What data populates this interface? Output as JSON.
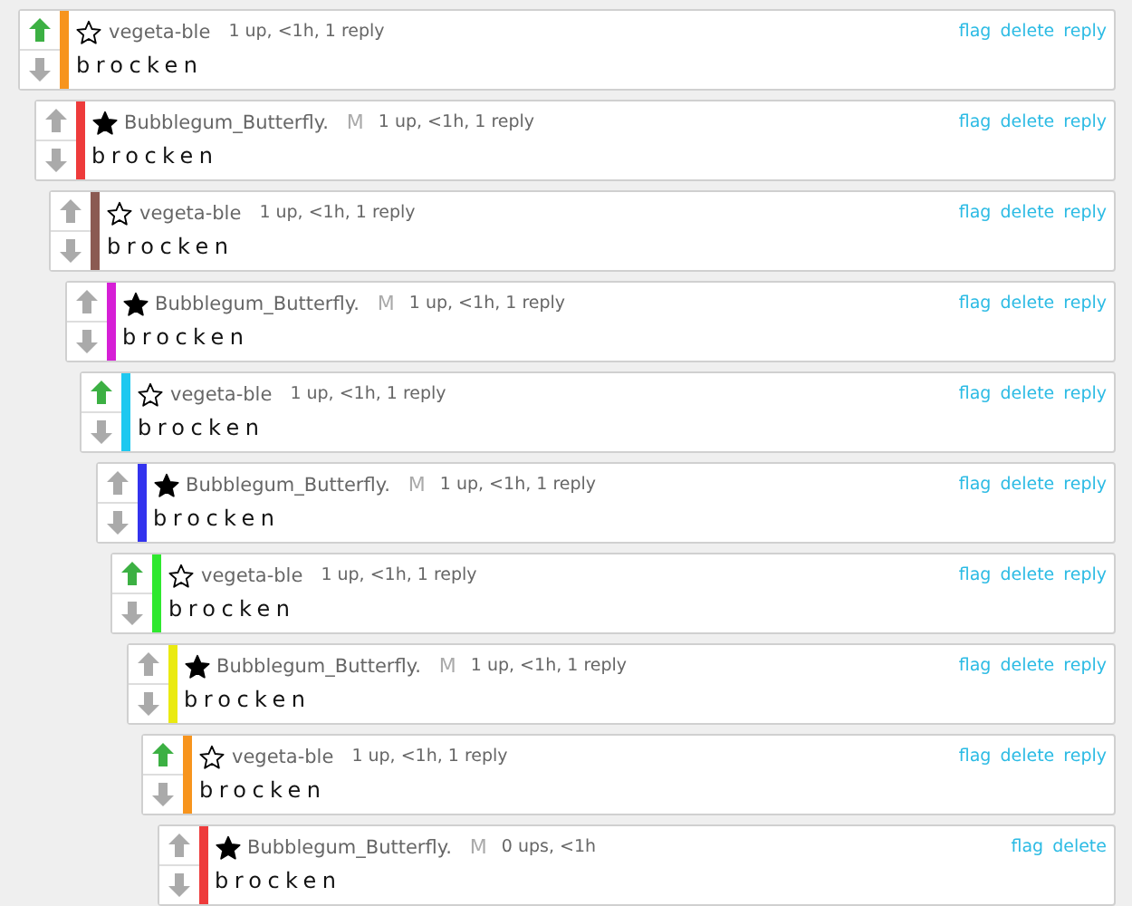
{
  "comments": [
    {
      "upvoted": true,
      "starred": false,
      "color": "#f7941d",
      "user": "vegeta-ble",
      "meta": "1 up, <1h, 1 reply",
      "body": "brocken",
      "actions": [
        "flag",
        "delete",
        "reply"
      ],
      "children": [
        {
          "upvoted": false,
          "starred": true,
          "color": "#ee3b3b",
          "user": "Bubblegum_Butterfly.",
          "badge": "M",
          "meta": "1 up, <1h, 1 reply",
          "body": "brocken",
          "actions": [
            "flag",
            "delete",
            "reply"
          ],
          "children": [
            {
              "upvoted": false,
              "starred": false,
              "color": "#8b5a52",
              "user": "vegeta-ble",
              "meta": "1 up, <1h, 1 reply",
              "body": "brocken",
              "actions": [
                "flag",
                "delete",
                "reply"
              ],
              "children": [
                {
                  "upvoted": false,
                  "starred": true,
                  "color": "#d61fd6",
                  "user": "Bubblegum_Butterfly.",
                  "badge": "M",
                  "meta": "1 up, <1h, 1 reply",
                  "body": "brocken",
                  "actions": [
                    "flag",
                    "delete",
                    "reply"
                  ],
                  "children": [
                    {
                      "upvoted": true,
                      "starred": false,
                      "color": "#1ec8f0",
                      "user": "vegeta-ble",
                      "meta": "1 up, <1h, 1 reply",
                      "body": "brocken",
                      "actions": [
                        "flag",
                        "delete",
                        "reply"
                      ],
                      "children": [
                        {
                          "upvoted": false,
                          "starred": true,
                          "color": "#3333ee",
                          "user": "Bubblegum_Butterfly.",
                          "badge": "M",
                          "meta": "1 up, <1h, 1 reply",
                          "body": "brocken",
                          "actions": [
                            "flag",
                            "delete",
                            "reply"
                          ],
                          "children": [
                            {
                              "upvoted": true,
                              "starred": false,
                              "color": "#2ee82e",
                              "user": "vegeta-ble",
                              "meta": "1 up, <1h, 1 reply",
                              "body": "brocken",
                              "actions": [
                                "flag",
                                "delete",
                                "reply"
                              ],
                              "children": [
                                {
                                  "upvoted": false,
                                  "starred": true,
                                  "color": "#eaea10",
                                  "user": "Bubblegum_Butterfly.",
                                  "badge": "M",
                                  "meta": "1 up, <1h, 1 reply",
                                  "body": "brocken",
                                  "actions": [
                                    "flag",
                                    "delete",
                                    "reply"
                                  ],
                                  "children": [
                                    {
                                      "upvoted": true,
                                      "starred": false,
                                      "color": "#f7941d",
                                      "user": "vegeta-ble",
                                      "meta": "1 up, <1h, 1 reply",
                                      "body": "brocken",
                                      "actions": [
                                        "flag",
                                        "delete",
                                        "reply"
                                      ],
                                      "children": [
                                        {
                                          "upvoted": false,
                                          "starred": true,
                                          "color": "#ee3b3b",
                                          "user": "Bubblegum_Butterfly.",
                                          "badge": "M",
                                          "meta": "0 ups, <1h",
                                          "body": "brocken",
                                          "actions": [
                                            "flag",
                                            "delete"
                                          ]
                                        }
                                      ]
                                    }
                                  ]
                                }
                              ]
                            }
                          ]
                        }
                      ]
                    }
                  ]
                }
              ]
            }
          ]
        }
      ]
    }
  ]
}
